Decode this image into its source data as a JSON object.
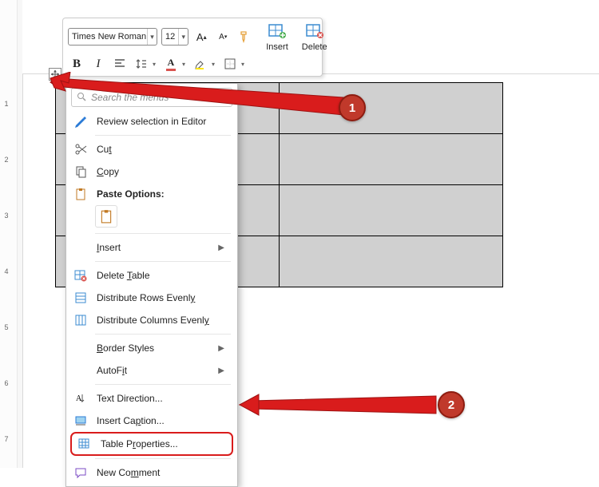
{
  "toolbar": {
    "font_name": "Times New Roman",
    "font_size": "12",
    "insert_label": "Insert",
    "delete_label": "Delete"
  },
  "menu": {
    "search_placeholder": "Search the menus",
    "review": "Review selection in Editor",
    "cut": "Cut",
    "copy": "Copy",
    "paste_options": "Paste Options:",
    "insert": "Insert",
    "delete_table": "Delete Table",
    "dist_rows": "Distribute Rows Evenly",
    "dist_cols": "Distribute Columns Evenly",
    "border_styles": "Border Styles",
    "autofit": "AutoFit",
    "text_direction": "Text Direction...",
    "insert_caption": "Insert Caption...",
    "table_properties": "Table Properties...",
    "new_comment": "New Comment"
  },
  "callouts": {
    "one": "1",
    "two": "2"
  },
  "ruler": {
    "n1": "1",
    "n2": "2",
    "n3": "3",
    "n4": "4",
    "n5": "5",
    "n6": "6",
    "n7": "7"
  }
}
